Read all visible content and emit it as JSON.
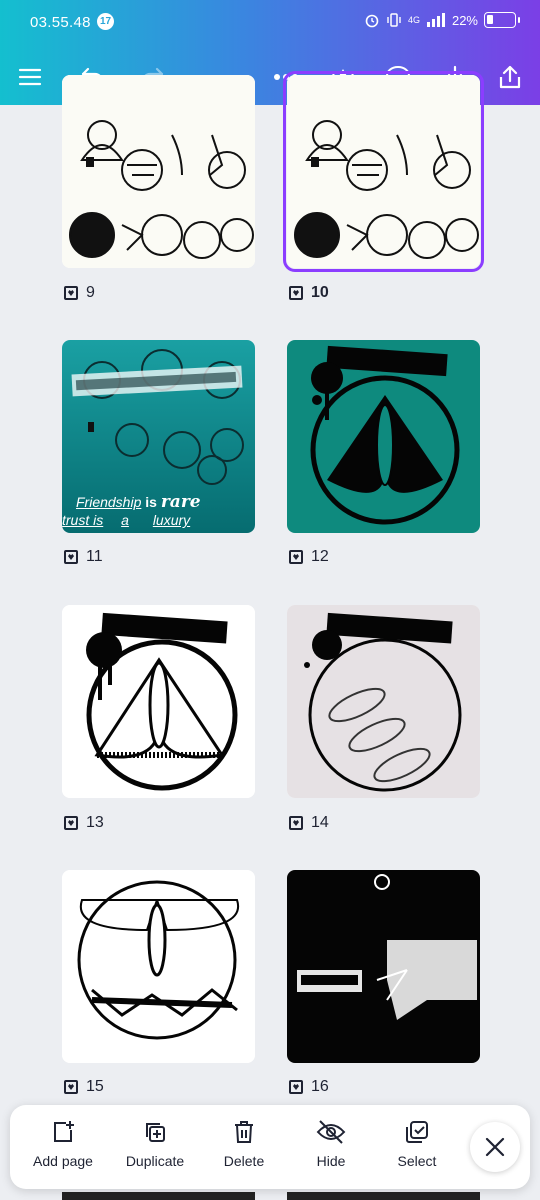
{
  "status_bar": {
    "time": "03.55.48",
    "notification_count": "17",
    "network": "4G",
    "battery": "22%"
  },
  "toolbar": {
    "icons": [
      "menu-icon",
      "undo-icon",
      "redo-icon",
      "more-icon",
      "crown-icon",
      "comment-icon",
      "download-icon",
      "share-icon"
    ]
  },
  "pages": [
    {
      "number": "9",
      "selected": false,
      "bold": false,
      "bg": "#fbfbf5",
      "image": "helmet sketches"
    },
    {
      "number": "10",
      "selected": true,
      "bold": true,
      "bg": "#fbfbf5",
      "image": "helmet sketches"
    },
    {
      "number": "11",
      "selected": false,
      "bold": false,
      "bg": "#0e8a8c",
      "image": "teal collage",
      "overlay_text": {
        "line1_a": "Friendship",
        "line1_b": "is",
        "line1_c": "rare",
        "line2_a": "trust is",
        "line2_b": "a",
        "line2_c": "luxury"
      }
    },
    {
      "number": "12",
      "selected": false,
      "bold": false,
      "bg": "#0e8a7e",
      "image": "moth in circle"
    },
    {
      "number": "13",
      "selected": false,
      "bold": false,
      "bg": "#ffffff",
      "image": "moth in circle"
    },
    {
      "number": "14",
      "selected": false,
      "bold": false,
      "bg": "#e6e1e4",
      "image": "trilobites in circle"
    },
    {
      "number": "15",
      "selected": false,
      "bold": false,
      "bg": "#ffffff",
      "image": "wasp in circle"
    },
    {
      "number": "16",
      "selected": false,
      "bold": false,
      "bg": "#050505",
      "image": "black poster"
    }
  ],
  "actions": [
    {
      "label": "Add page",
      "icon": "add-page-icon"
    },
    {
      "label": "Duplicate",
      "icon": "duplicate-icon"
    },
    {
      "label": "Delete",
      "icon": "trash-icon"
    },
    {
      "label": "Hide",
      "icon": "eye-off-icon"
    },
    {
      "label": "Select",
      "icon": "select-icon"
    }
  ],
  "colors": {
    "accent": "#8b3dff",
    "header_start": "#14bfcf",
    "header_end": "#7b3fe6"
  }
}
